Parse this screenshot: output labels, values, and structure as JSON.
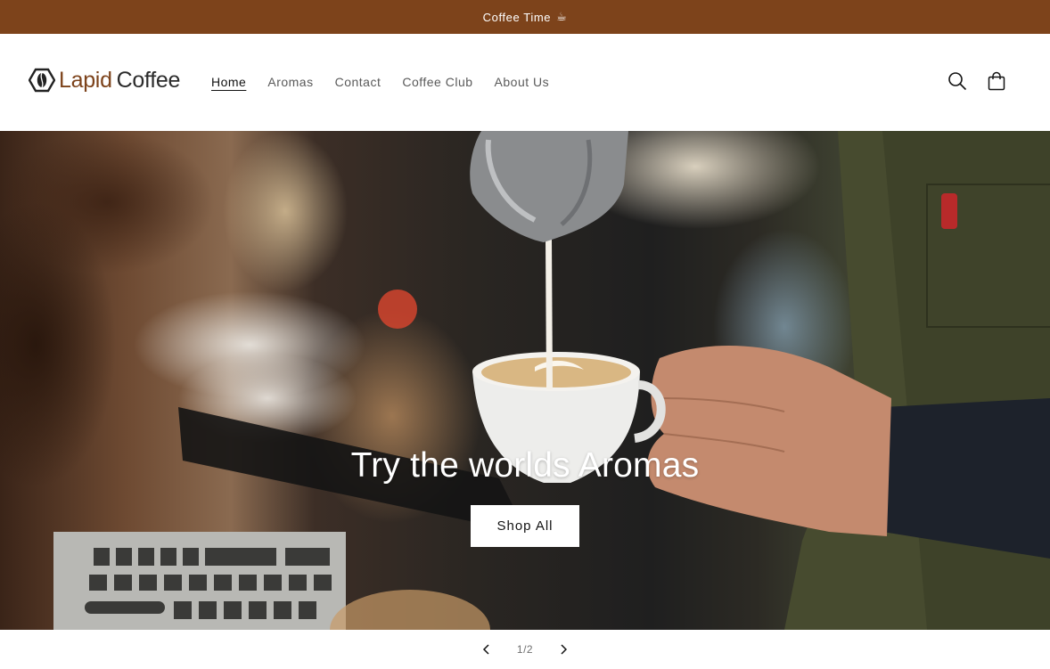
{
  "announcement": {
    "text": "Coffee Time",
    "icon": "coffee-cup-icon"
  },
  "header": {
    "logo": {
      "word1": "Lapid",
      "word2": "Coffee",
      "icon": "coffee-bean-hexagon-icon"
    },
    "nav": [
      {
        "label": "Home",
        "active": true
      },
      {
        "label": "Aromas"
      },
      {
        "label": "Contact"
      },
      {
        "label": "Coffee Club"
      },
      {
        "label": "About Us"
      }
    ],
    "icons": {
      "search": "search-icon",
      "cart": "cart-icon"
    }
  },
  "hero": {
    "title": "Try the worlds Aromas",
    "button": "Shop All"
  },
  "slider": {
    "counter": "1/2",
    "prev": "chevron-left-icon",
    "next": "chevron-right-icon"
  },
  "colors": {
    "brand": "#7d431b",
    "text": "#121212"
  }
}
